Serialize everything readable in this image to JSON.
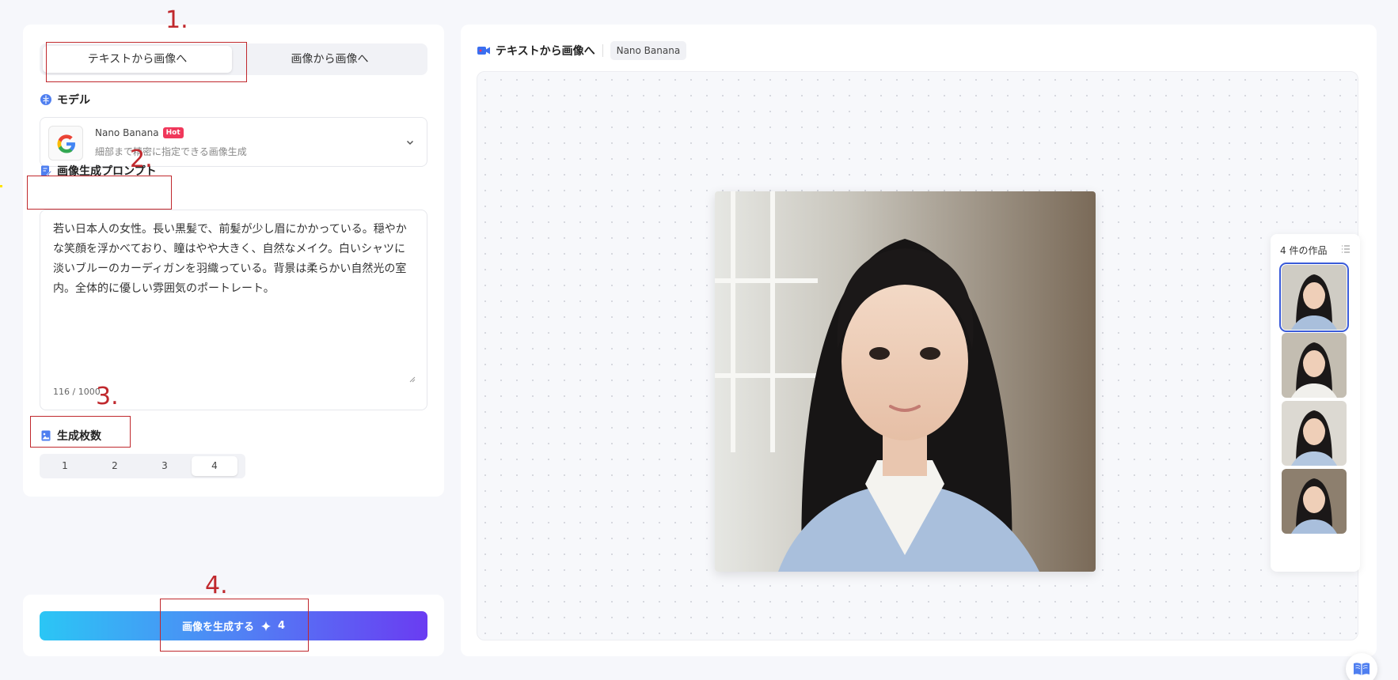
{
  "mode_tabs": [
    {
      "label": "テキストから画像へ",
      "active": true
    },
    {
      "label": "画像から画像へ",
      "active": false
    }
  ],
  "model_section": {
    "title": "モデル",
    "model_name": "Nano Banana",
    "badge": "Hot",
    "description": "細部まで精密に指定できる画像生成"
  },
  "prompt_section": {
    "title": "画像生成プロンプト",
    "text": "若い日本人の女性。長い黒髪で、前髪が少し眉にかかっている。穏やかな笑顔を浮かべており、瞳はやや大きく、自然なメイク。白いシャツに淡いブルーのカーディガンを羽織っている。背景は柔らかい自然光の室内。全体的に優しい雰囲気のポートレート。",
    "char_count": "116 / 1000"
  },
  "count_section": {
    "title": "生成枚数",
    "options": [
      "1",
      "2",
      "3",
      "4"
    ],
    "selected": "4"
  },
  "generate_button": {
    "label": "画像を生成する",
    "credits": "4"
  },
  "right_panel": {
    "title": "テキストから画像へ",
    "model_badge": "Nano Banana"
  },
  "works": {
    "title": "4 件の作品",
    "count": 4,
    "selected_index": 0
  },
  "annotations": [
    "1.",
    "2.",
    "3.",
    "4."
  ],
  "colors": {
    "accent": "#3a5bd9",
    "hot": "#f0385b",
    "annotation": "#c0282d",
    "button_start": "#2bc6f5",
    "button_end": "#6a3cf2"
  },
  "icons": {
    "model": "brain-icon",
    "prompt": "edit-doc-icon",
    "count": "image-stack-icon",
    "header": "video-camera-icon",
    "help": "book-icon"
  }
}
